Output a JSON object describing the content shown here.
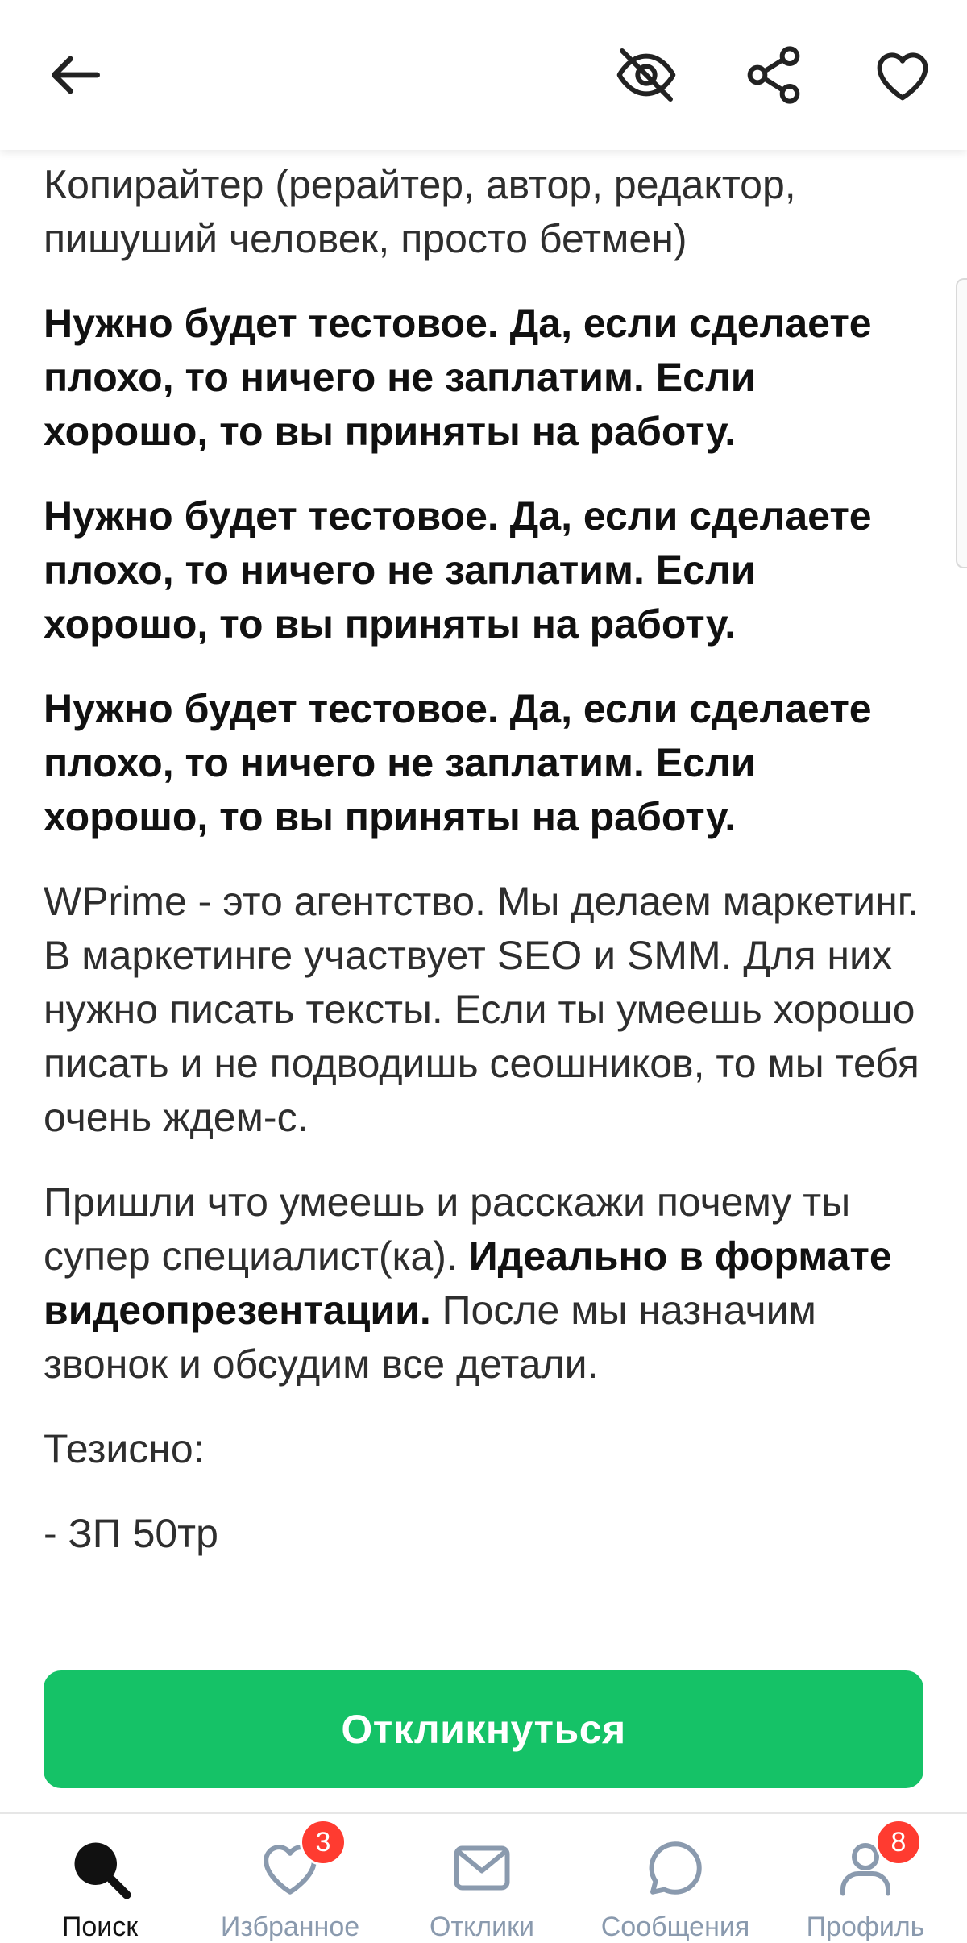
{
  "header": {
    "back_icon": "arrow-left-icon",
    "hide_icon": "eye-off-icon",
    "share_icon": "share-icon",
    "favorite_icon": "heart-icon"
  },
  "description": {
    "title_line": "Копирайтер (рерайтер, автор, редактор, пишуший человек, просто бетмен)",
    "bold_paragraphs": [
      "Нужно будет тестовое. Да, если сделаете плохо, то ничего не заплатим. Если хорошо, то вы приняты на работу.",
      "Нужно будет тестовое. Да, если сделаете плохо, то ничего не заплатим. Если хорошо, то вы приняты на работу.",
      "Нужно будет тестовое. Да, если сделаете плохо, то ничего не заплатим. Если хорошо, то вы приняты на работу."
    ],
    "about": "WPrime - это агентство. Мы делаем маркетинг. В маркетинге участвует SEO и SMM. Для них нужно писать тексты. Если ты умеешь хорошо писать и не подводишь сеошников, то мы тебя очень ждем-с.",
    "call_start": "Пришли что умеешь и расскажи почему ты супер специалист(ка). ",
    "call_bold": "Идеально в формате видеопрезентации.",
    "call_end": " После мы назначим звонок и обсудим все детали.",
    "theses_title": "Тезисно:",
    "theses_item": "- ЗП 50тр"
  },
  "cta": {
    "label": "Откликнуться"
  },
  "tabbar": {
    "items": [
      {
        "label": "Поиск",
        "icon": "search-icon",
        "active": true
      },
      {
        "label": "Избранное",
        "icon": "heart-icon",
        "badge": "3"
      },
      {
        "label": "Отклики",
        "icon": "envelope-icon"
      },
      {
        "label": "Сообщения",
        "icon": "chat-bubble-icon"
      },
      {
        "label": "Профиль",
        "icon": "user-icon",
        "badge": "8"
      }
    ]
  },
  "colors": {
    "accent": "#15c267",
    "badge": "#ff3b30",
    "inactive": "#8a9aae"
  }
}
